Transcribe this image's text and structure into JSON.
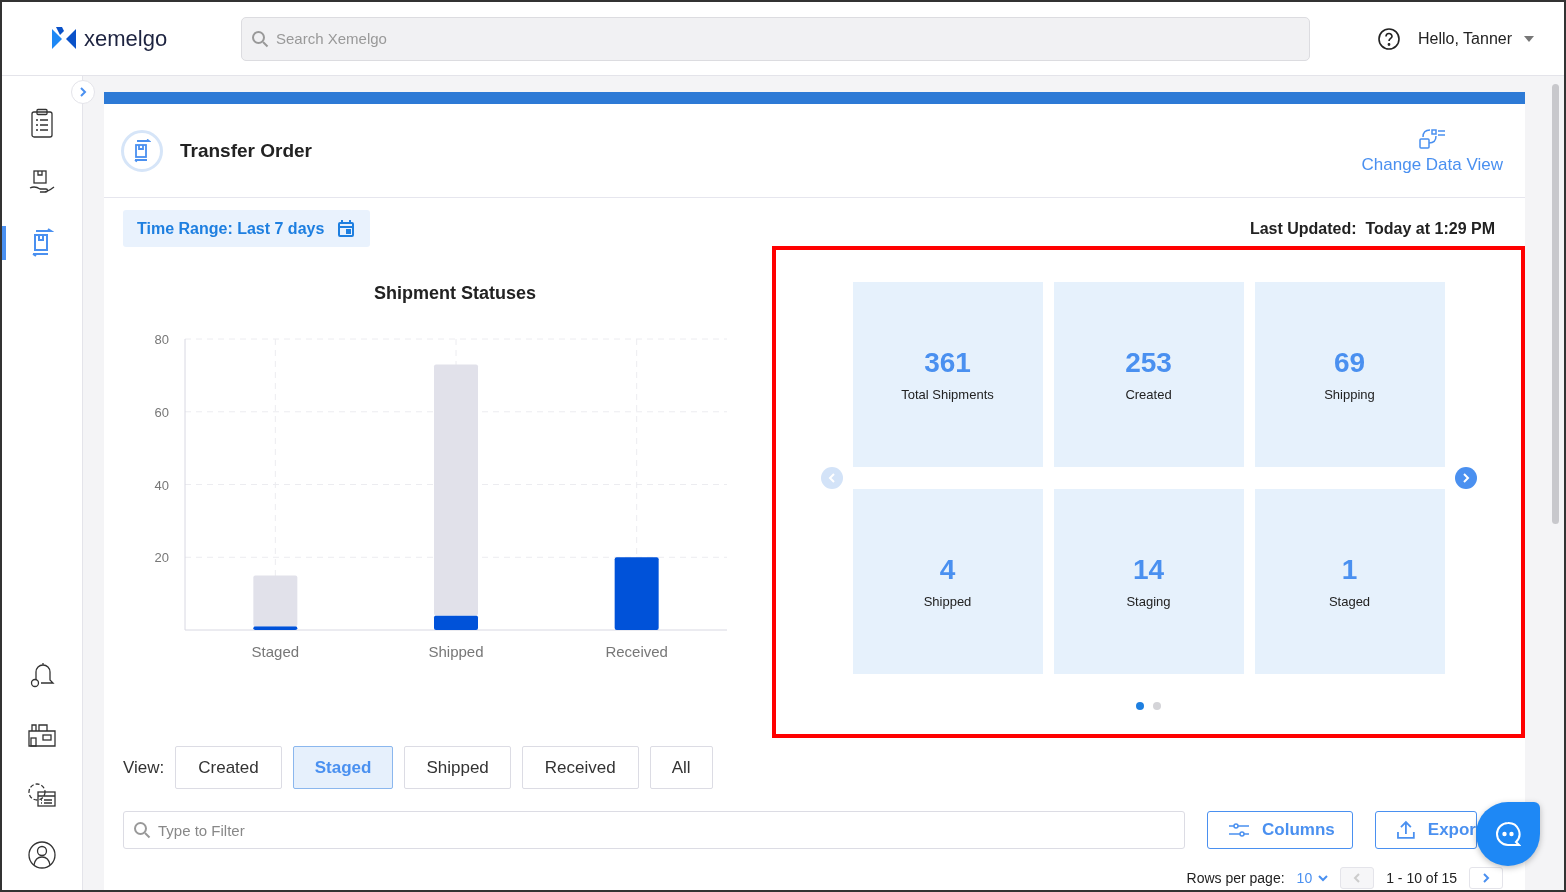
{
  "header": {
    "logo": "xemelgo",
    "search": {
      "placeholder": "Search Xemelgo"
    },
    "greeting": "Hello, Tanner"
  },
  "sidebar": {
    "items": [
      {
        "selected": false
      },
      {
        "selected": false
      },
      {
        "selected": true
      }
    ]
  },
  "page": {
    "title": "Transfer Order",
    "change_view": "Change Data View",
    "time_range": "Time Range: Last 7 days",
    "last_updated_label": "Last Updated:",
    "last_updated_value": "Today at 1:29 PM"
  },
  "chart_data": {
    "type": "bar",
    "title": "Shipment Statuses",
    "categories": [
      "Staged",
      "Shipped",
      "Received"
    ],
    "stacked": true,
    "grid": true,
    "ylim": [
      0,
      80
    ],
    "yticks": [
      20,
      40,
      60,
      80
    ],
    "series": [
      {
        "color": "#0052d9",
        "values": [
          1,
          4,
          20
        ]
      },
      {
        "color": "#e1e1ea",
        "values": [
          14,
          69,
          0
        ]
      }
    ]
  },
  "view": {
    "label": "View:",
    "options": [
      {
        "label": "Created",
        "selected": false
      },
      {
        "label": "Staged",
        "selected": true
      },
      {
        "label": "Shipped",
        "selected": false
      },
      {
        "label": "Received",
        "selected": false
      },
      {
        "label": "All",
        "selected": false
      }
    ]
  },
  "metrics": [
    {
      "value": "361",
      "label": "Total Shipments"
    },
    {
      "value": "253",
      "label": "Created"
    },
    {
      "value": "69",
      "label": "Shipping"
    },
    {
      "value": "4",
      "label": "Shipped"
    },
    {
      "value": "14",
      "label": "Staging"
    },
    {
      "value": "1",
      "label": "Staged"
    }
  ],
  "carousel": {
    "prev": {
      "disabled": true
    },
    "next": {
      "disabled": false
    },
    "pages": [
      {
        "selected": true
      },
      {
        "selected": false
      }
    ]
  },
  "filter": {
    "placeholder": "Type to Filter"
  },
  "actions": [
    {
      "label": "Columns",
      "kind": "columns"
    },
    {
      "label": "Expor",
      "kind": "export"
    }
  ],
  "pagination": {
    "rows_label": "Rows per page:",
    "rows_value": "10",
    "range": "1 - 10 of 15",
    "prev": {
      "disabled": true
    },
    "next": {
      "disabled": false
    }
  }
}
